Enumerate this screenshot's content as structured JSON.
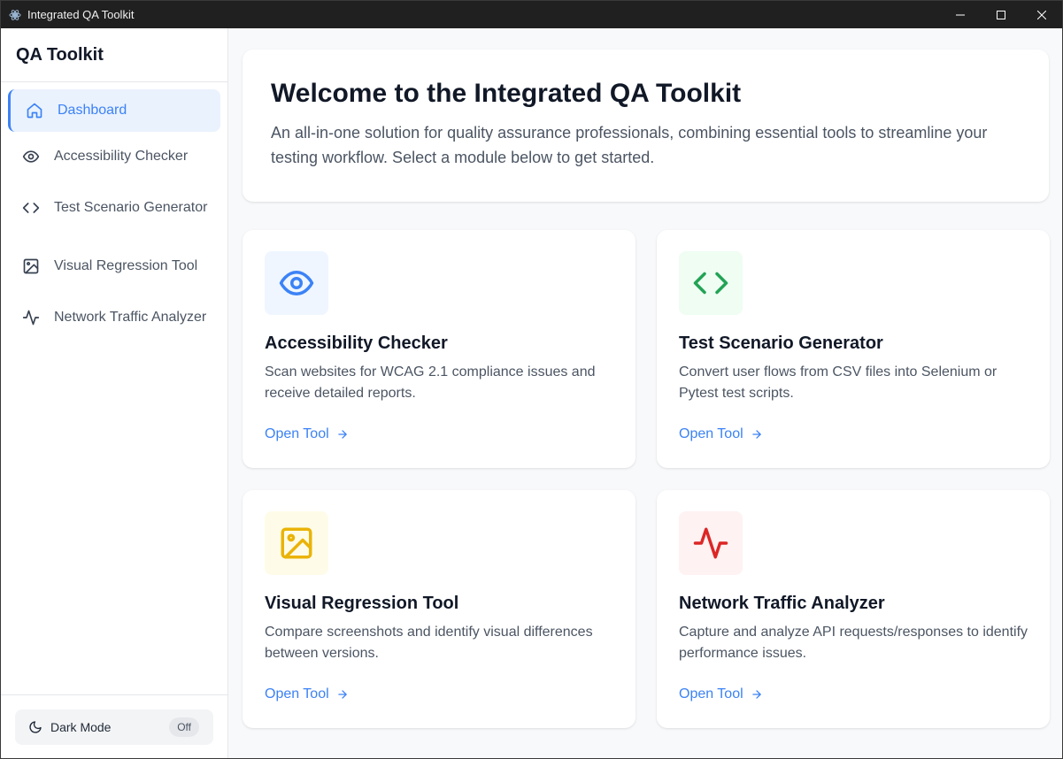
{
  "window": {
    "title": "Integrated QA Toolkit"
  },
  "sidebar": {
    "brand": "QA Toolkit",
    "items": [
      {
        "label": "Dashboard",
        "icon": "home-icon",
        "active": true
      },
      {
        "label": "Accessibility Checker",
        "icon": "eye-icon"
      },
      {
        "label": "Test Scenario Generator",
        "icon": "code-icon"
      },
      {
        "label": "Visual Regression Tool",
        "icon": "image-icon"
      },
      {
        "label": "Network Traffic Analyzer",
        "icon": "activity-icon"
      }
    ],
    "dark_mode": {
      "label": "Dark Mode",
      "state": "Off",
      "icon": "moon-icon"
    }
  },
  "main": {
    "hero": {
      "title": "Welcome to the Integrated QA Toolkit",
      "description": "An all-in-one solution for quality assurance professionals, combining essential tools to streamline your testing workflow. Select a module below to get started."
    },
    "cards": [
      {
        "title": "Accessibility Checker",
        "description": "Scan websites for WCAG 2.1 compliance issues and receive detailed reports.",
        "link": "Open Tool",
        "icon": "eye-icon",
        "icon_color": "#3b82f6",
        "icon_bg": "#eff6ff"
      },
      {
        "title": "Test Scenario Generator",
        "description": "Convert user flows from CSV files into Selenium or Pytest test scripts.",
        "link": "Open Tool",
        "icon": "code-icon",
        "icon_color": "#22a355",
        "icon_bg": "#effdf3"
      },
      {
        "title": "Visual Regression Tool",
        "description": "Compare screenshots and identify visual differences between versions.",
        "link": "Open Tool",
        "icon": "image-icon",
        "icon_color": "#eab308",
        "icon_bg": "#fefce8"
      },
      {
        "title": "Network Traffic Analyzer",
        "description": "Capture and analyze API requests/responses to identify performance issues.",
        "link": "Open Tool",
        "icon": "activity-icon",
        "icon_color": "#dc2626",
        "icon_bg": "#fef2f2"
      }
    ]
  },
  "colors": {
    "accent": "#3b82f6",
    "active_nav_bg": "#eaf2fe"
  }
}
